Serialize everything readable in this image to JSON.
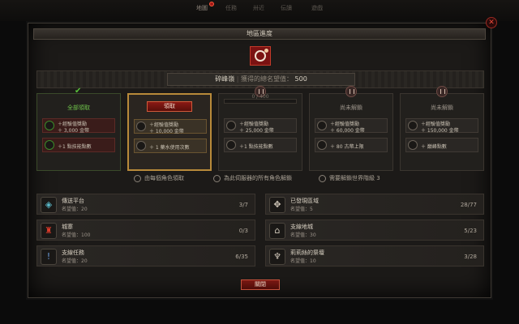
{
  "nav": {
    "tabs": [
      "地圖",
      "任務",
      "卅近",
      "伝讀",
      "遊戲"
    ],
    "active_index": 0
  },
  "window": {
    "title": "地區進度",
    "close_symbol": "✕"
  },
  "region": {
    "name": "碎峰嶺",
    "rep_label": "獲得的總名望值：",
    "rep_value": "500"
  },
  "cards": [
    {
      "title": "全部領取",
      "state": "claimed",
      "row1": {
        "line1": "＋經驗值獎勵",
        "line2": "＋ 3,000 金幣"
      },
      "row2": {
        "line1": "＋1 點技能點數"
      }
    },
    {
      "title": "",
      "claim_label": "領取",
      "state": "current",
      "row1": {
        "line1": "＋經驗值獎勵",
        "line2": "＋ 10,000 金幣"
      },
      "row2": {
        "line1": "＋ 1 藥水使用次數"
      }
    },
    {
      "title": "0 / 400",
      "state": "locked",
      "progress": 0.0,
      "row1": {
        "line1": "＋經驗值獎勵",
        "line2": "＋ 25,000 金幣"
      },
      "row2": {
        "line1": "＋1 點技能點數"
      }
    },
    {
      "title": "尚未解鎖",
      "state": "locked",
      "row1": {
        "line1": "＋經驗值獎勵",
        "line2": "＋ 60,000 金幣"
      },
      "row2": {
        "line1": "＋ 80 古幣上限"
      }
    },
    {
      "title": "尚未解鎖",
      "state": "locked",
      "row1": {
        "line1": "＋經驗值獎勵",
        "line2": "＋ 150,000 金幣"
      },
      "row2": {
        "line1": "＋ 巔峰點數"
      }
    }
  ],
  "legend": [
    {
      "text": "由每個角色領取"
    },
    {
      "text": "為此伺服器的所有角色解鎖"
    },
    {
      "text": "需要解鎖世界階級 3"
    }
  ],
  "stats": [
    {
      "name": "傳送平台",
      "rep": "名望值：20",
      "count": "3/7",
      "icon": "waypoint-icon",
      "glyph": "◈"
    },
    {
      "name": "已發現區域",
      "rep": "名望值：5",
      "count": "28/77",
      "icon": "compass-icon",
      "glyph": "✥"
    },
    {
      "name": "城寨",
      "rep": "名望值：100",
      "count": "0/3",
      "icon": "stronghold-icon",
      "glyph": "♜"
    },
    {
      "name": "支線地城",
      "rep": "名望值：30",
      "count": "5/23",
      "icon": "dungeon-icon",
      "glyph": "⌂"
    },
    {
      "name": "支線任務",
      "rep": "名望值：20",
      "count": "6/35",
      "icon": "quest-icon",
      "glyph": "!"
    },
    {
      "name": "莉莉絲的祭壇",
      "rep": "名望值：10",
      "count": "3/28",
      "icon": "altar-icon",
      "glyph": "♆"
    }
  ],
  "footer": {
    "close_label": "關閉"
  }
}
